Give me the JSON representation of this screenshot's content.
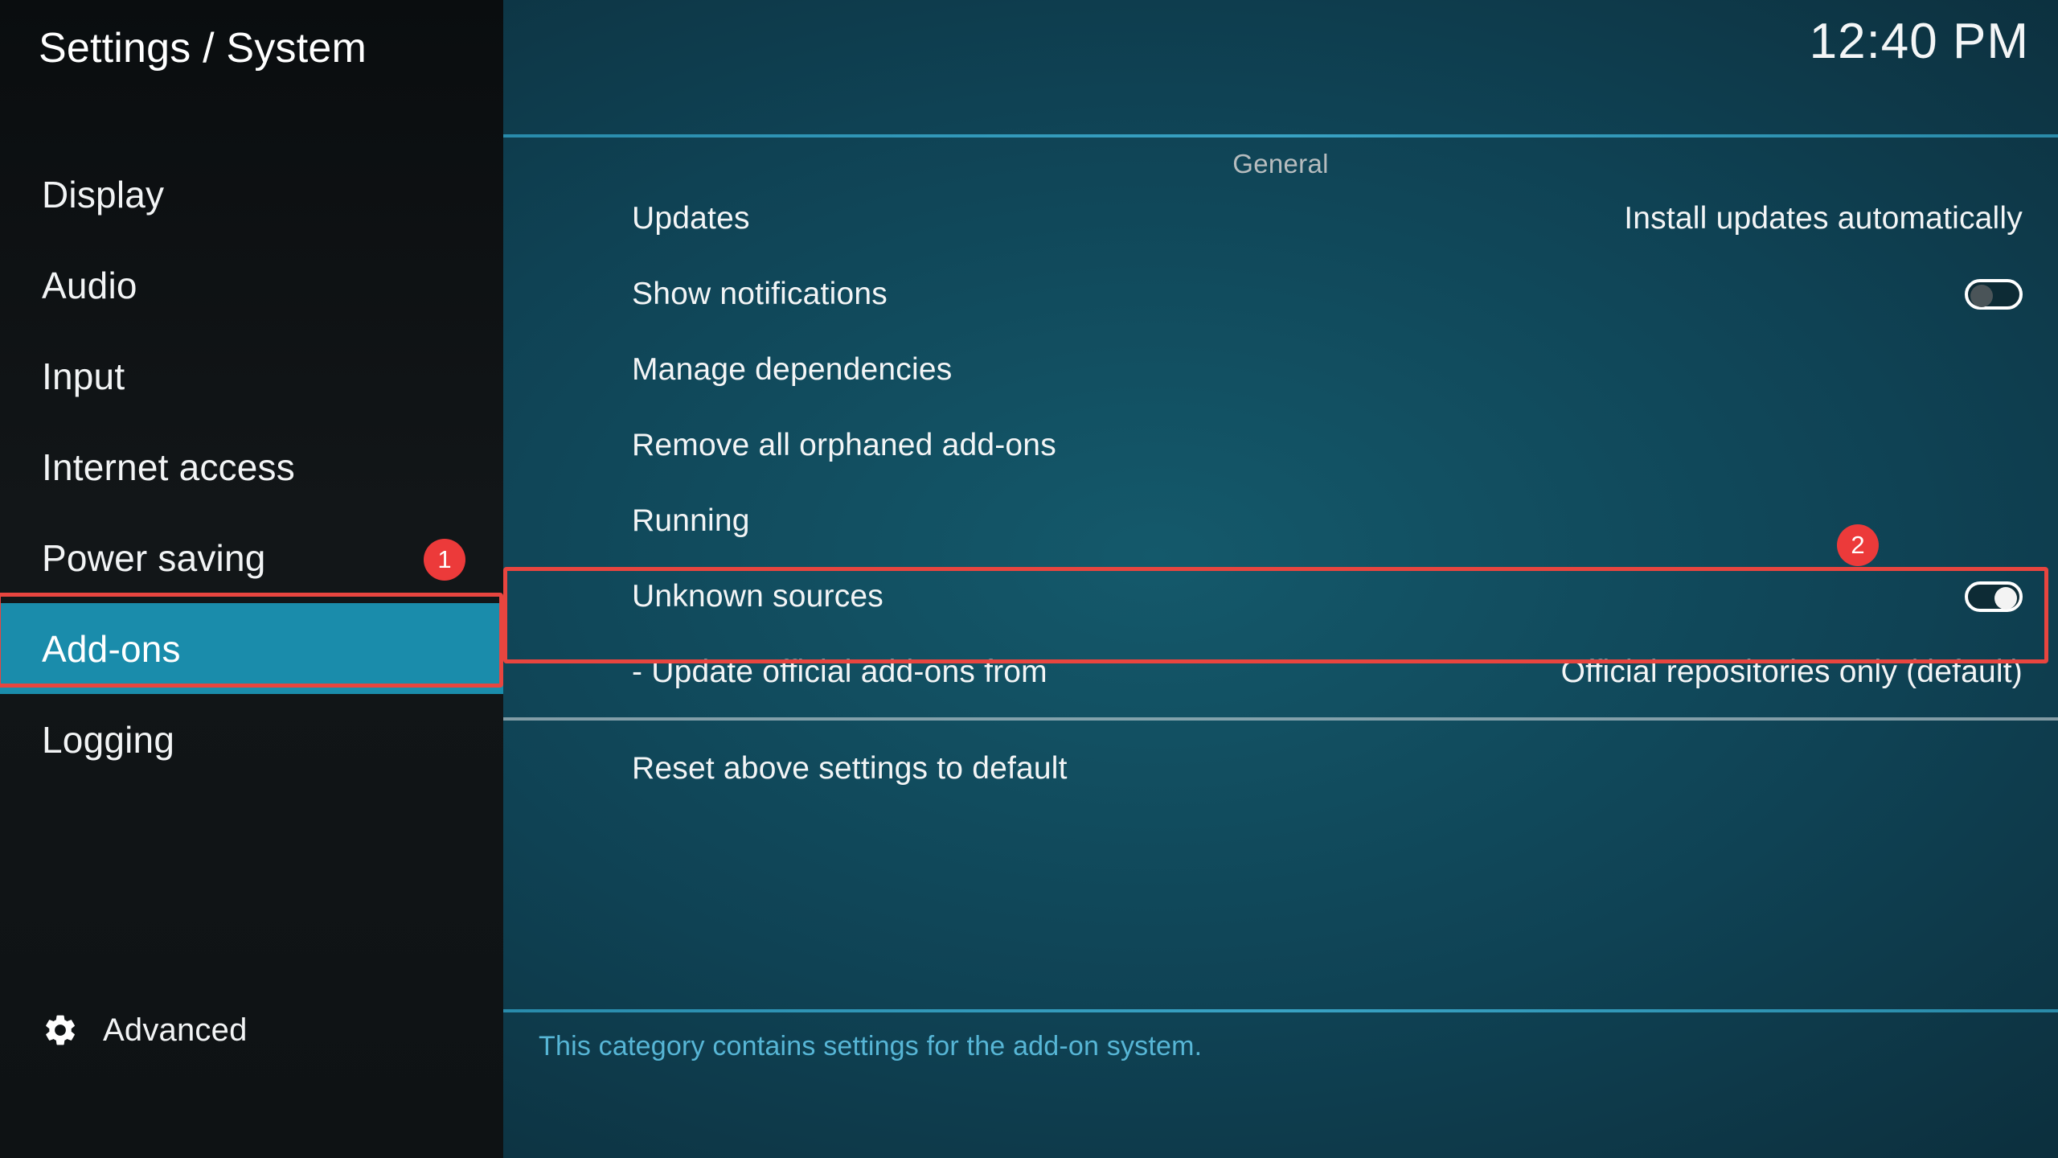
{
  "window": {
    "title": "Settings / System",
    "clock": "12:40 PM"
  },
  "sidebar": {
    "items": [
      {
        "label": "Display",
        "selected": false,
        "badge": null
      },
      {
        "label": "Audio",
        "selected": false,
        "badge": null
      },
      {
        "label": "Input",
        "selected": false,
        "badge": null
      },
      {
        "label": "Internet access",
        "selected": false,
        "badge": null
      },
      {
        "label": "Power saving",
        "selected": false,
        "badge": null
      },
      {
        "label": "Add-ons",
        "selected": true,
        "badge": null
      },
      {
        "label": "Logging",
        "selected": false,
        "badge": null
      }
    ],
    "advanced": {
      "label": "Advanced",
      "icon": "gear-icon"
    }
  },
  "annotations": {
    "step1": {
      "number": "1",
      "target": "sidebar-item-add-ons",
      "color": "#ec3a3a"
    },
    "step2": {
      "number": "2",
      "target": "setting-row-unknown-sources",
      "color": "#ec3a3a"
    },
    "highlight_color": "#e8453f"
  },
  "main": {
    "group_header": "General",
    "rows": [
      {
        "label": "Updates",
        "value": "Install updates automatically",
        "control": "text",
        "separator": false,
        "highlighted": false
      },
      {
        "label": "Show notifications",
        "value": "",
        "control": "toggle",
        "toggle_on": false,
        "separator": false,
        "highlighted": false
      },
      {
        "label": "Manage dependencies",
        "value": "",
        "control": "none",
        "separator": false,
        "highlighted": false
      },
      {
        "label": "Remove all orphaned add-ons",
        "value": "",
        "control": "none",
        "separator": false,
        "highlighted": false
      },
      {
        "label": "Running",
        "value": "",
        "control": "none",
        "separator": false,
        "highlighted": false
      },
      {
        "label": "Unknown sources",
        "value": "",
        "control": "toggle",
        "toggle_on": true,
        "separator": false,
        "highlighted": true
      },
      {
        "label": "- Update official add-ons from",
        "value": "Official repositories only (default)",
        "control": "text",
        "separator": true,
        "highlighted": false
      },
      {
        "label": "Reset above settings to default",
        "value": "",
        "control": "none",
        "separator": false,
        "highlighted": false
      }
    ]
  },
  "footer": {
    "description": "This category contains settings for the add-on system."
  },
  "colors": {
    "accent_teal": "#1a8cab",
    "annotation_red": "#e8453f",
    "badge_red": "#ec3a3a",
    "footer_text": "#57b6d6",
    "separator_teal": "#3ba7c9"
  }
}
